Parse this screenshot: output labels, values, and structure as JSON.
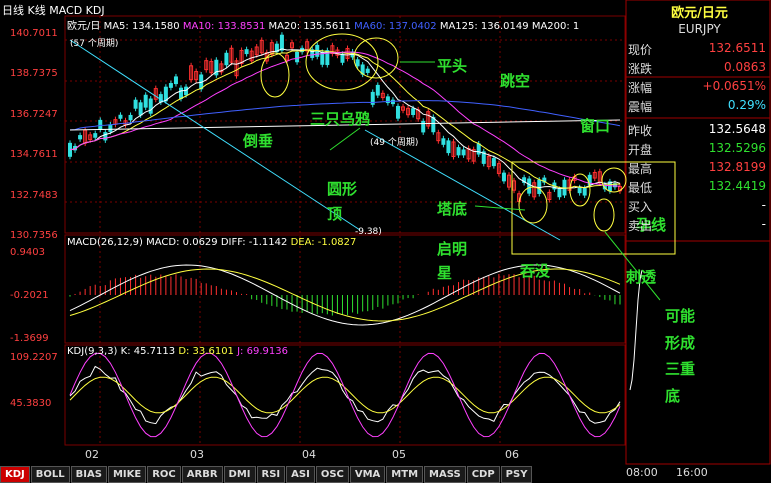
{
  "header": {
    "title": "日线 K线 MACD KDJ"
  },
  "ma_line": {
    "symbol": "欧元/日",
    "ma5": "MA5: 134.1580",
    "ma10": "MA10: 133.8531",
    "ma20": "MA20: 135.5611",
    "ma60": "MA60: 137.0402",
    "ma125": "MA125: 136.0149",
    "ma200": "MA200: 1"
  },
  "price_axis": [
    "140.7011",
    "138.7375",
    "136.7247",
    "134.7611",
    "132.7483",
    "130.7356"
  ],
  "period_labels": {
    "p57": "(57 个周期)",
    "p49": "(49 个周期)",
    "low": "-9.38)"
  },
  "macd": {
    "title": "MACD(26,12,9)",
    "macd": "MACD: 0.0629",
    "diff": "DIFF: -1.1142",
    "dea": "DEA: -1.0827",
    "axis": [
      "0.9403",
      "-0.2021",
      "-1.3699"
    ]
  },
  "kdj": {
    "title": "KDJ(9,3,3)",
    "k": "K: 45.7113",
    "d": "D: 33.6101",
    "j": "J: 69.9136",
    "axis": [
      "109.2207",
      "45.3830"
    ]
  },
  "x_axis": [
    "02",
    "03",
    "04",
    "05",
    "06"
  ],
  "annotations": {
    "pingtou": "平头",
    "tiaokong": "跳空",
    "sanzhi": "三只乌鸦",
    "daochui": "倒垂",
    "yuanxing": "圆形",
    "ding": "顶",
    "chuangkou": "窗口",
    "tadi": "塔底",
    "qiming": "启明",
    "xing": "星",
    "tunmo": "吞没",
    "yunxian": "孕线",
    "citou": "刺透",
    "keneng": "可能",
    "xingcheng": "形成",
    "sanchong": "三重",
    "di": "底"
  },
  "side": {
    "title": "欧元/日元",
    "code": "EURJPY",
    "rows": [
      {
        "label": "现价",
        "value": "132.6511",
        "color": "#ff4040"
      },
      {
        "label": "涨跌",
        "value": "0.0863",
        "color": "#ff4040"
      },
      {
        "label": "涨幅",
        "value": "+0.0651%",
        "color": "#ff4040"
      },
      {
        "label": "震幅",
        "value": "0.29%",
        "color": "#40e0ff"
      },
      {
        "label": "昨收",
        "value": "132.5648",
        "color": "#ffffff"
      },
      {
        "label": "开盘",
        "value": "132.5296",
        "color": "#2fe02f"
      },
      {
        "label": "最高",
        "value": "132.8199",
        "color": "#ff4040"
      },
      {
        "label": "最低",
        "value": "132.4419",
        "color": "#2fe02f"
      },
      {
        "label": "买入",
        "value": "-",
        "color": "#ffffff"
      },
      {
        "label": "卖出",
        "value": "-",
        "color": "#ffffff"
      }
    ],
    "times": [
      "08:00",
      "16:00"
    ]
  },
  "tabs": [
    "KDJ",
    "BOLL",
    "BIAS",
    "MIKE",
    "ROC",
    "ARBR",
    "DMI",
    "RSI",
    "ASI",
    "OSC",
    "VMA",
    "MTM",
    "MASS",
    "CDP",
    "PSY"
  ],
  "colors": {
    "up": "#ff3030",
    "down": "#30e0e0",
    "annotation": "#2fe02f",
    "grid": "#7a0000"
  }
}
